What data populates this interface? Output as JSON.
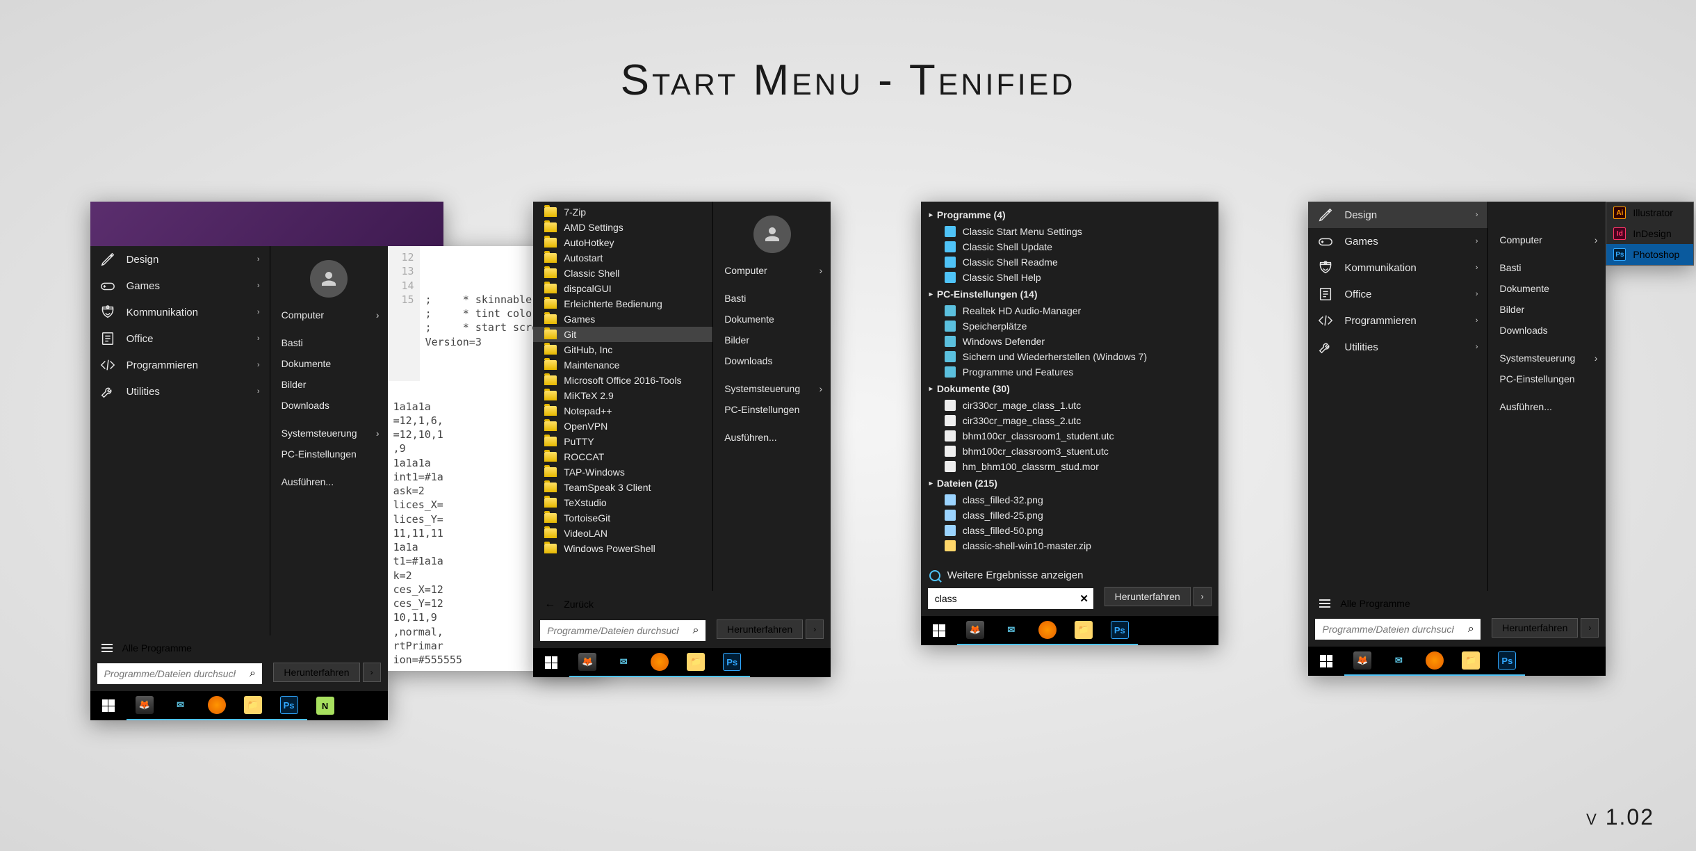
{
  "title": "Start Menu  -  Tenified",
  "version": "v 1.02",
  "categories": [
    "Design",
    "Games",
    "Kommunikation",
    "Office",
    "Programmieren",
    "Utilities"
  ],
  "right_items": {
    "computer": "Computer",
    "basti": "Basti",
    "dokumente": "Dokumente",
    "bilder": "Bilder",
    "downloads": "Downloads",
    "systemsteuerung": "Systemsteuerung",
    "pceinst": "PC-Einstellungen",
    "ausfuehren": "Ausführen..."
  },
  "all_programs": "Alle Programme",
  "back": "Zurück",
  "search_placeholder": "Programme/Dateien durchsuchen",
  "shutdown": "Herunterfahren",
  "shutdown_arrow": "›",
  "editor": {
    "line_numbers": [
      "12",
      "13",
      "14",
      "15"
    ],
    "lines": [
      ";     * skinnable scrollbars",
      ";     * tint colors",
      ";     * start screen colors",
      "Version=3"
    ],
    "frag": [
      "1a1a1a",
      "=12,1,6,",
      "=12,10,1",
      ",9",
      "1a1a1a",
      "int1=#1a",
      "ask=2",
      "lices_X=",
      "lices_Y=",
      "11,11,11",
      "1a1a",
      "t1=#1a1a",
      "k=2",
      "ces_X=12",
      "ces_Y=12",
      "10,11,9",
      ",normal,",
      "rtPrimar",
      "ion=#555555"
    ]
  },
  "folders": [
    "7-Zip",
    "AMD Settings",
    "AutoHotkey",
    "Autostart",
    "Classic Shell",
    "dispcalGUI",
    "Erleichterte Bedienung",
    "Games",
    "Git",
    "GitHub, Inc",
    "Maintenance",
    "Microsoft Office 2016-Tools",
    "MiKTeX 2.9",
    "Notepad++",
    "OpenVPN",
    "PuTTY",
    "ROCCAT",
    "TAP-Windows",
    "TeamSpeak 3 Client",
    "TeXstudio",
    "TortoiseGit",
    "VideoLAN",
    "Windows PowerShell"
  ],
  "folder_selected": "Git",
  "search": {
    "query": "class",
    "groups": [
      {
        "name": "Programme",
        "count": 4,
        "icon": "shell",
        "items": [
          "Classic Start Menu Settings",
          "Classic Shell Update",
          "Classic Shell Readme",
          "Classic Shell Help"
        ]
      },
      {
        "name": "PC-Einstellungen",
        "count": 14,
        "icon": "cfg",
        "items": [
          "Realtek HD Audio-Manager",
          "Speicherplätze",
          "Windows Defender",
          "Sichern und Wiederherstellen (Windows 7)",
          "Programme und Features"
        ]
      },
      {
        "name": "Dokumente",
        "count": 30,
        "icon": "file",
        "items": [
          "cir330cr_mage_class_1.utc",
          "cir330cr_mage_class_2.utc",
          "bhm100cr_classroom1_student.utc",
          "bhm100cr_classroom3_stuent.utc",
          "hm_bhm100_classrm_stud.mor"
        ]
      },
      {
        "name": "Dateien",
        "count": 215,
        "icon": "png",
        "items": [
          "class_filled-32.png",
          "class_filled-25.png",
          "class_filled-50.png",
          "classic-shell-win10-master.zip"
        ]
      }
    ],
    "more": "Weitere Ergebnisse anzeigen"
  },
  "flyout": {
    "items": [
      {
        "label": "Illustrator",
        "cls": "il",
        "short": "Ai"
      },
      {
        "label": "InDesign",
        "cls": "id",
        "short": "Id"
      },
      {
        "label": "Photoshop",
        "cls": "ps2",
        "short": "Ps"
      }
    ],
    "selected": "Photoshop"
  }
}
